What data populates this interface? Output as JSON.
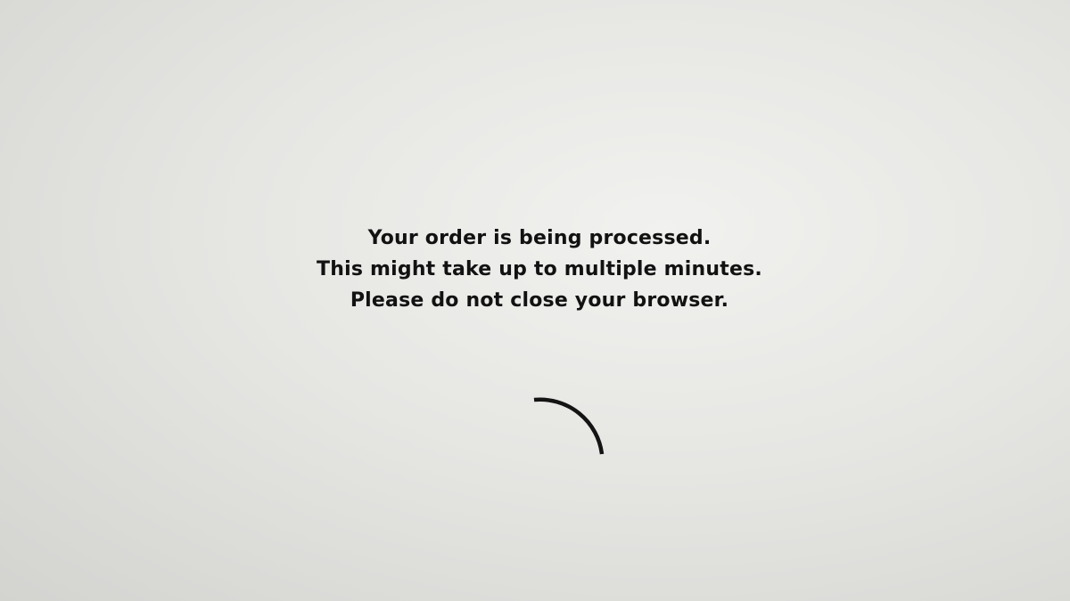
{
  "message": {
    "lines": [
      "Your order is being processed.",
      "This might take up to multiple minutes.",
      "Please do not close your browser."
    ]
  },
  "spinner": {
    "icon": "loading-spinner-icon",
    "color": "#141414"
  },
  "colors": {
    "background": "#e6e6e3",
    "text": "#121212"
  }
}
